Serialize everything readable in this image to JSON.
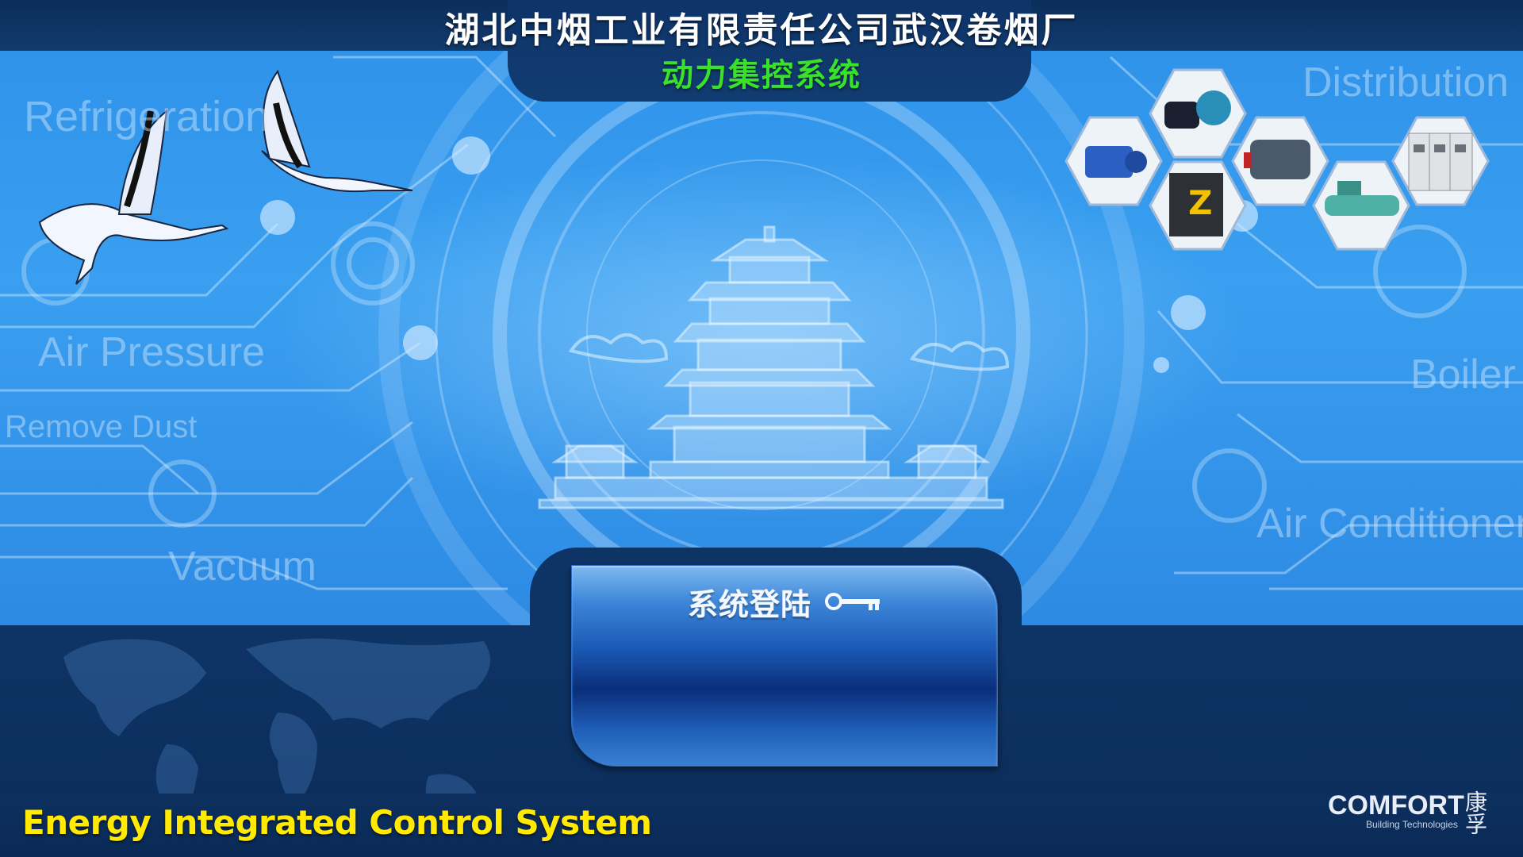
{
  "header": {
    "company_title": "湖北中烟工业有限责任公司武汉卷烟厂",
    "system_subtitle": "动力集控系统"
  },
  "categories": {
    "refrigeration": "Refrigeration",
    "air_pressure": "Air Pressure",
    "remove_dust": "Remove Dust",
    "vacuum": "Vacuum",
    "distribution": "Distribution",
    "boiler": "Boiler",
    "air_conditioner": "Air Conditioner"
  },
  "login": {
    "label": "系统登陆",
    "icon": "key-icon"
  },
  "footer": {
    "slogan": "Energy Integrated Control System"
  },
  "brand": {
    "name": "COMFORT",
    "tagline": "Building Technologies",
    "cn_mark": "康孚"
  },
  "equipment_icons": [
    "pump-icon",
    "water-pump-icon",
    "compressor-icon",
    "boiler-icon",
    "chiller-icon",
    "switchgear-icon"
  ],
  "colors": {
    "title": "#ffffff",
    "subtitle": "#39e12b",
    "slogan": "#ffea00",
    "background_dark": "#0e3466",
    "background_light": "#3a9ff0"
  }
}
